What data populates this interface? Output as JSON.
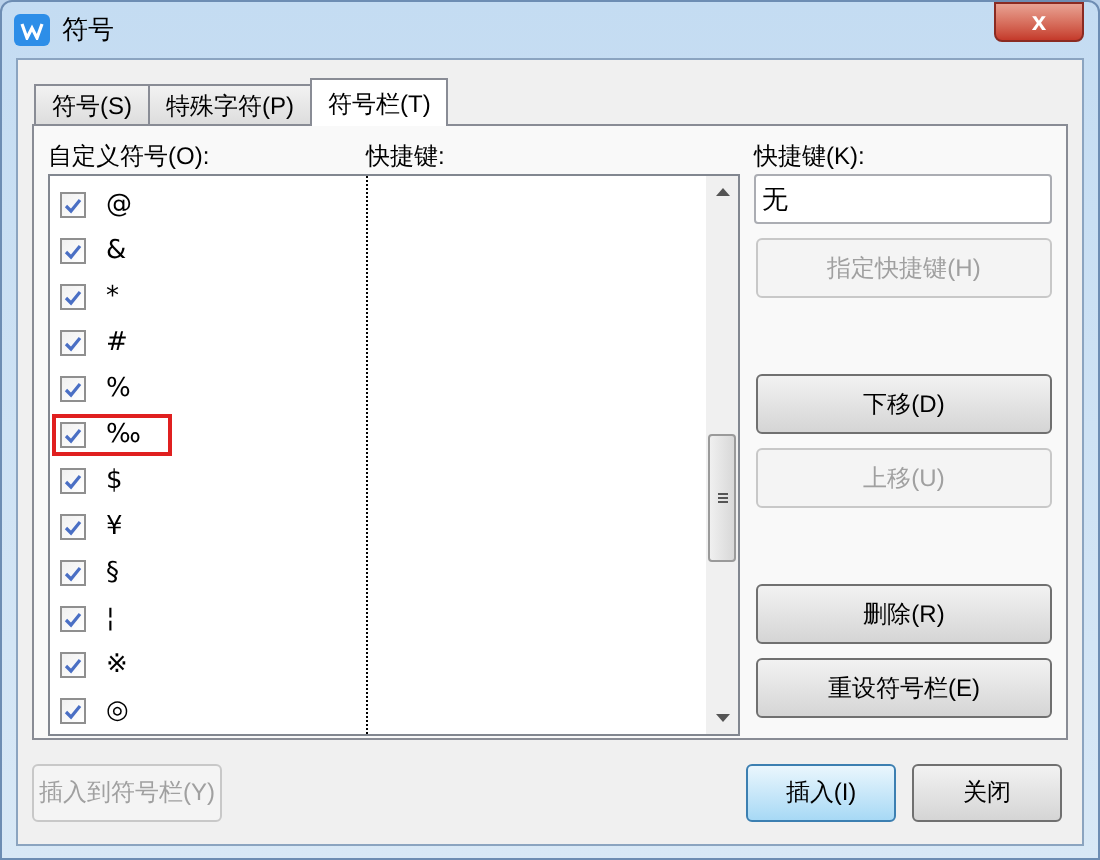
{
  "window": {
    "title": "符号",
    "close": "x"
  },
  "tabs": [
    {
      "label": "符号(S)",
      "selected": false
    },
    {
      "label": "特殊字符(P)",
      "selected": false
    },
    {
      "label": "符号栏(T)",
      "selected": true
    }
  ],
  "list_label": "自定义符号(O):",
  "shortcut_column": "快捷键:",
  "symbols": [
    {
      "symbol": "@",
      "checked": true,
      "highlighted": false
    },
    {
      "symbol": "&",
      "checked": true,
      "highlighted": false
    },
    {
      "symbol": "*",
      "checked": true,
      "highlighted": false
    },
    {
      "symbol": "#",
      "checked": true,
      "highlighted": false
    },
    {
      "symbol": "%",
      "checked": true,
      "highlighted": false
    },
    {
      "symbol": "‰",
      "checked": true,
      "highlighted": true
    },
    {
      "symbol": "$",
      "checked": true,
      "highlighted": false
    },
    {
      "symbol": "¥",
      "checked": true,
      "highlighted": false
    },
    {
      "symbol": "§",
      "checked": true,
      "highlighted": false
    },
    {
      "symbol": "¦",
      "checked": true,
      "highlighted": false
    },
    {
      "symbol": "※",
      "checked": true,
      "highlighted": false
    },
    {
      "symbol": "◎",
      "checked": true,
      "highlighted": false
    }
  ],
  "shortcut": {
    "label": "快捷键(K):",
    "value": "无"
  },
  "side_buttons": [
    {
      "label": "指定快捷键(H)",
      "disabled": true
    },
    {
      "label": "下移(D)",
      "disabled": false
    },
    {
      "label": "上移(U)",
      "disabled": true
    },
    {
      "label": "删除(R)",
      "disabled": false
    },
    {
      "label": "重设符号栏(E)",
      "disabled": false
    }
  ],
  "bottom_buttons": [
    {
      "label": "插入到符号栏(Y)",
      "disabled": true,
      "default": false
    },
    {
      "label": "插入(I)",
      "disabled": false,
      "default": true
    },
    {
      "label": "关闭",
      "disabled": false,
      "default": false
    }
  ]
}
